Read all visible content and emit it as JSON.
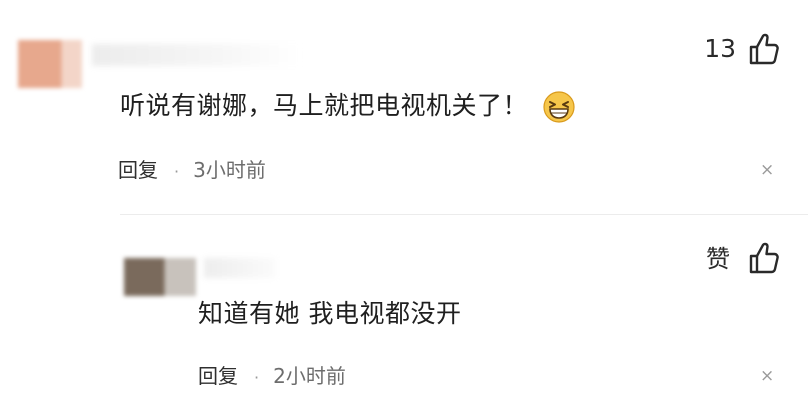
{
  "main_comment": {
    "like_count": "13",
    "text": "听说有谢娜，马上就把电视机关了！",
    "emoji": "grinning-squint-emoji",
    "reply_label": "回复",
    "separator": "·",
    "time": "3小时前",
    "close": "×"
  },
  "reply_comment": {
    "like_label": "赞",
    "text": "知道有她 我电视都没开",
    "reply_label": "回复",
    "separator": "·",
    "time": "2小时前",
    "close": "×"
  },
  "colors": {
    "text": "#1f1f1f",
    "meta": "#6d6d6d",
    "emoji_face": "#f6c64a"
  }
}
